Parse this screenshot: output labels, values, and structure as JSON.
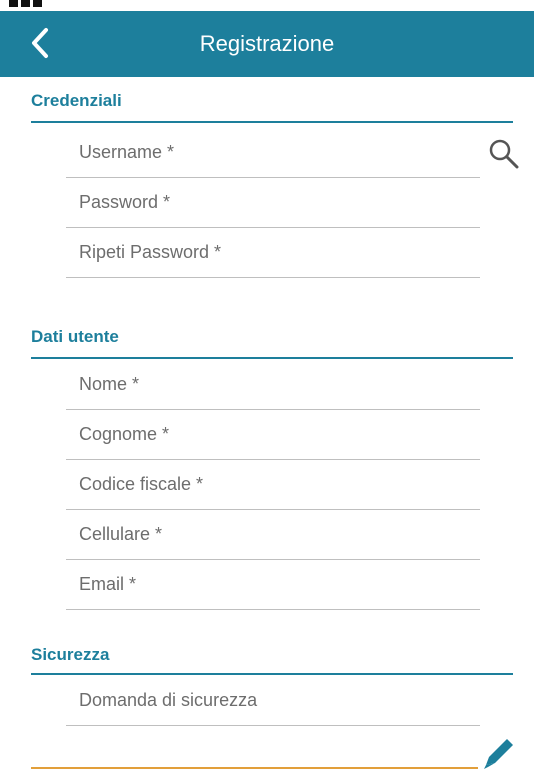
{
  "app_bar": {
    "title": "Registrazione"
  },
  "sections": [
    {
      "header": "Credenziali",
      "fields": [
        "Username *",
        "Password *",
        "Ripeti Password *"
      ]
    },
    {
      "header": "Dati utente",
      "fields": [
        "Nome *",
        "Cognome *",
        "Codice fiscale *",
        "Cellulare *",
        "Email *"
      ]
    },
    {
      "header": "Sicurezza",
      "fields": [
        "Domanda di sicurezza"
      ]
    }
  ],
  "icons": {
    "back": "chevron-left-icon",
    "search": "search-icon",
    "edit": "pencil-icon"
  },
  "colors": {
    "primary": "#1d7f9c",
    "accent": "#e29f3a",
    "field_text": "#6d6d6d",
    "divider": "#bfbfbf"
  }
}
